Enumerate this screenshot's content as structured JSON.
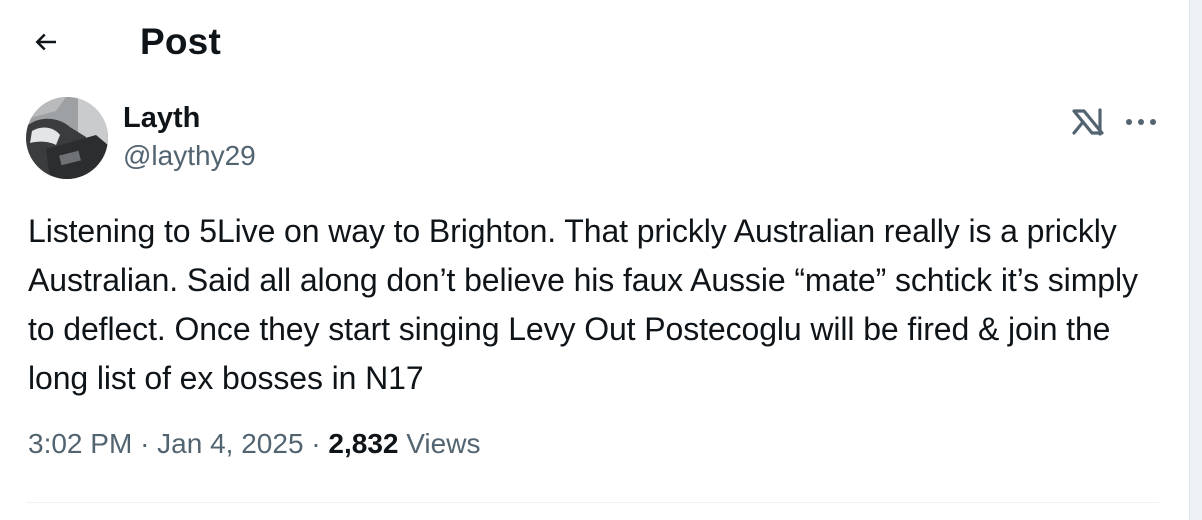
{
  "header": {
    "title": "Post",
    "back_icon": "arrow-left-icon"
  },
  "post": {
    "author": {
      "display_name": "Layth",
      "handle": "@laythy29",
      "avatar_icon": "user-avatar"
    },
    "actions": {
      "grok_icon": "grok-icon",
      "more_icon": "more-horizontal-icon"
    },
    "text": "Listening to 5Live on way to Brighton. That prickly Australian really is a prickly Australian. Said all along don’t believe his faux Aussie “mate” schtick it’s simply to deflect. Once they start singing Levy Out Postecoglu will be fired & join the long list of ex bosses in N17",
    "time": "3:02 PM",
    "separator": "·",
    "date": "Jan 4, 2025",
    "views_count": "2,832",
    "views_label": "Views"
  },
  "colors": {
    "text_primary": "#0f1419",
    "text_secondary": "#536471",
    "divider": "#eff3f4",
    "background": "#ffffff"
  }
}
